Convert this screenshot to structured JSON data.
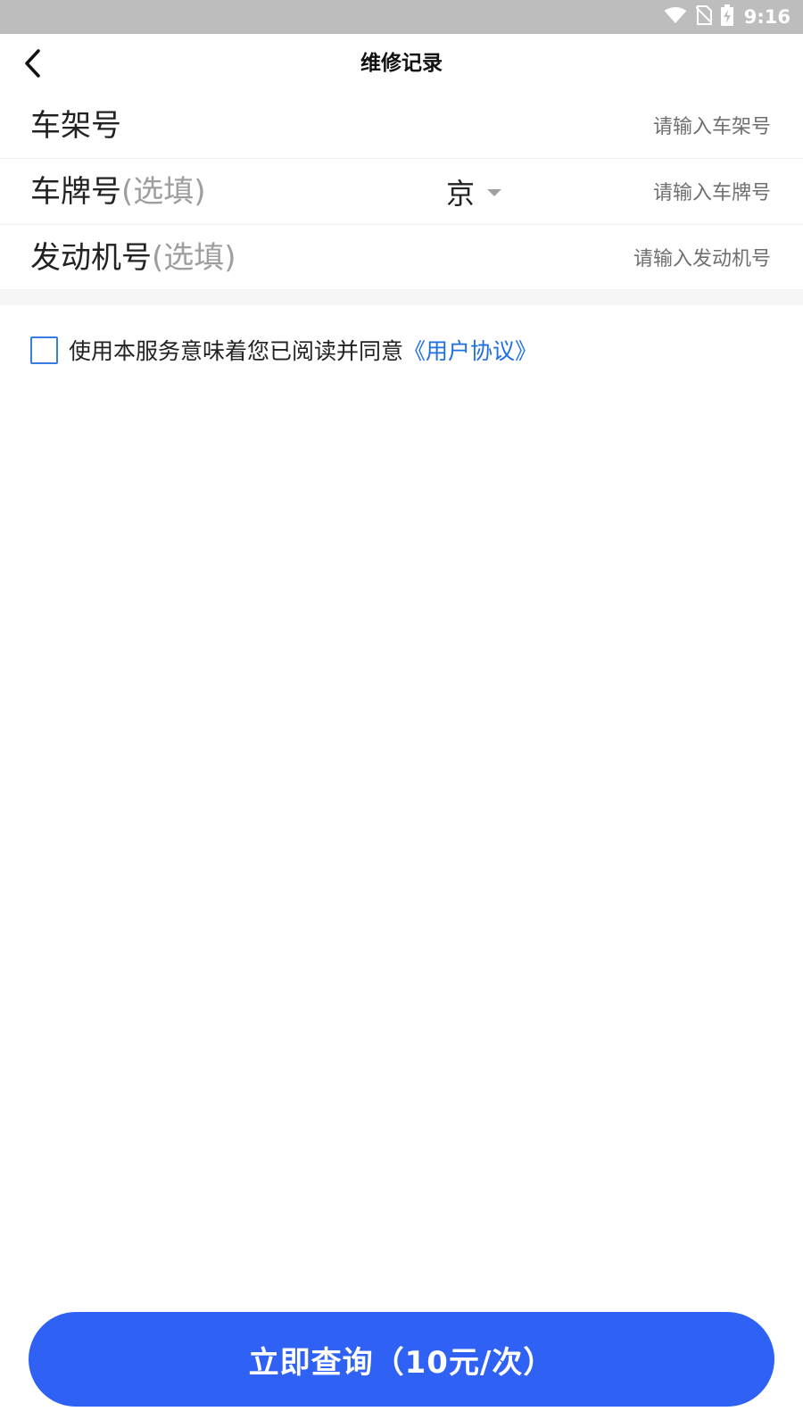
{
  "status_bar": {
    "time": "9:16",
    "icons": [
      "wifi-icon",
      "no-sim-icon",
      "battery-charging-icon"
    ]
  },
  "nav": {
    "title": "维修记录",
    "back_icon": "chevron-left-icon"
  },
  "form": {
    "vin": {
      "label": "车架号",
      "placeholder": "请输入车架号"
    },
    "plate": {
      "label": "车牌号",
      "optional": "(选填)",
      "province": "京",
      "placeholder": "请输入车牌号"
    },
    "engine": {
      "label": "发动机号",
      "optional": "(选填)",
      "placeholder": "请输入发动机号"
    }
  },
  "agreement": {
    "text": "使用本服务意味着您已阅读并同意",
    "link": "《用户协议》"
  },
  "submit": {
    "label": "立即查询（10元/次）"
  },
  "colors": {
    "accent": "#2f61f5",
    "link": "#1e6fe0",
    "status_bar": "#bdbdbd"
  }
}
